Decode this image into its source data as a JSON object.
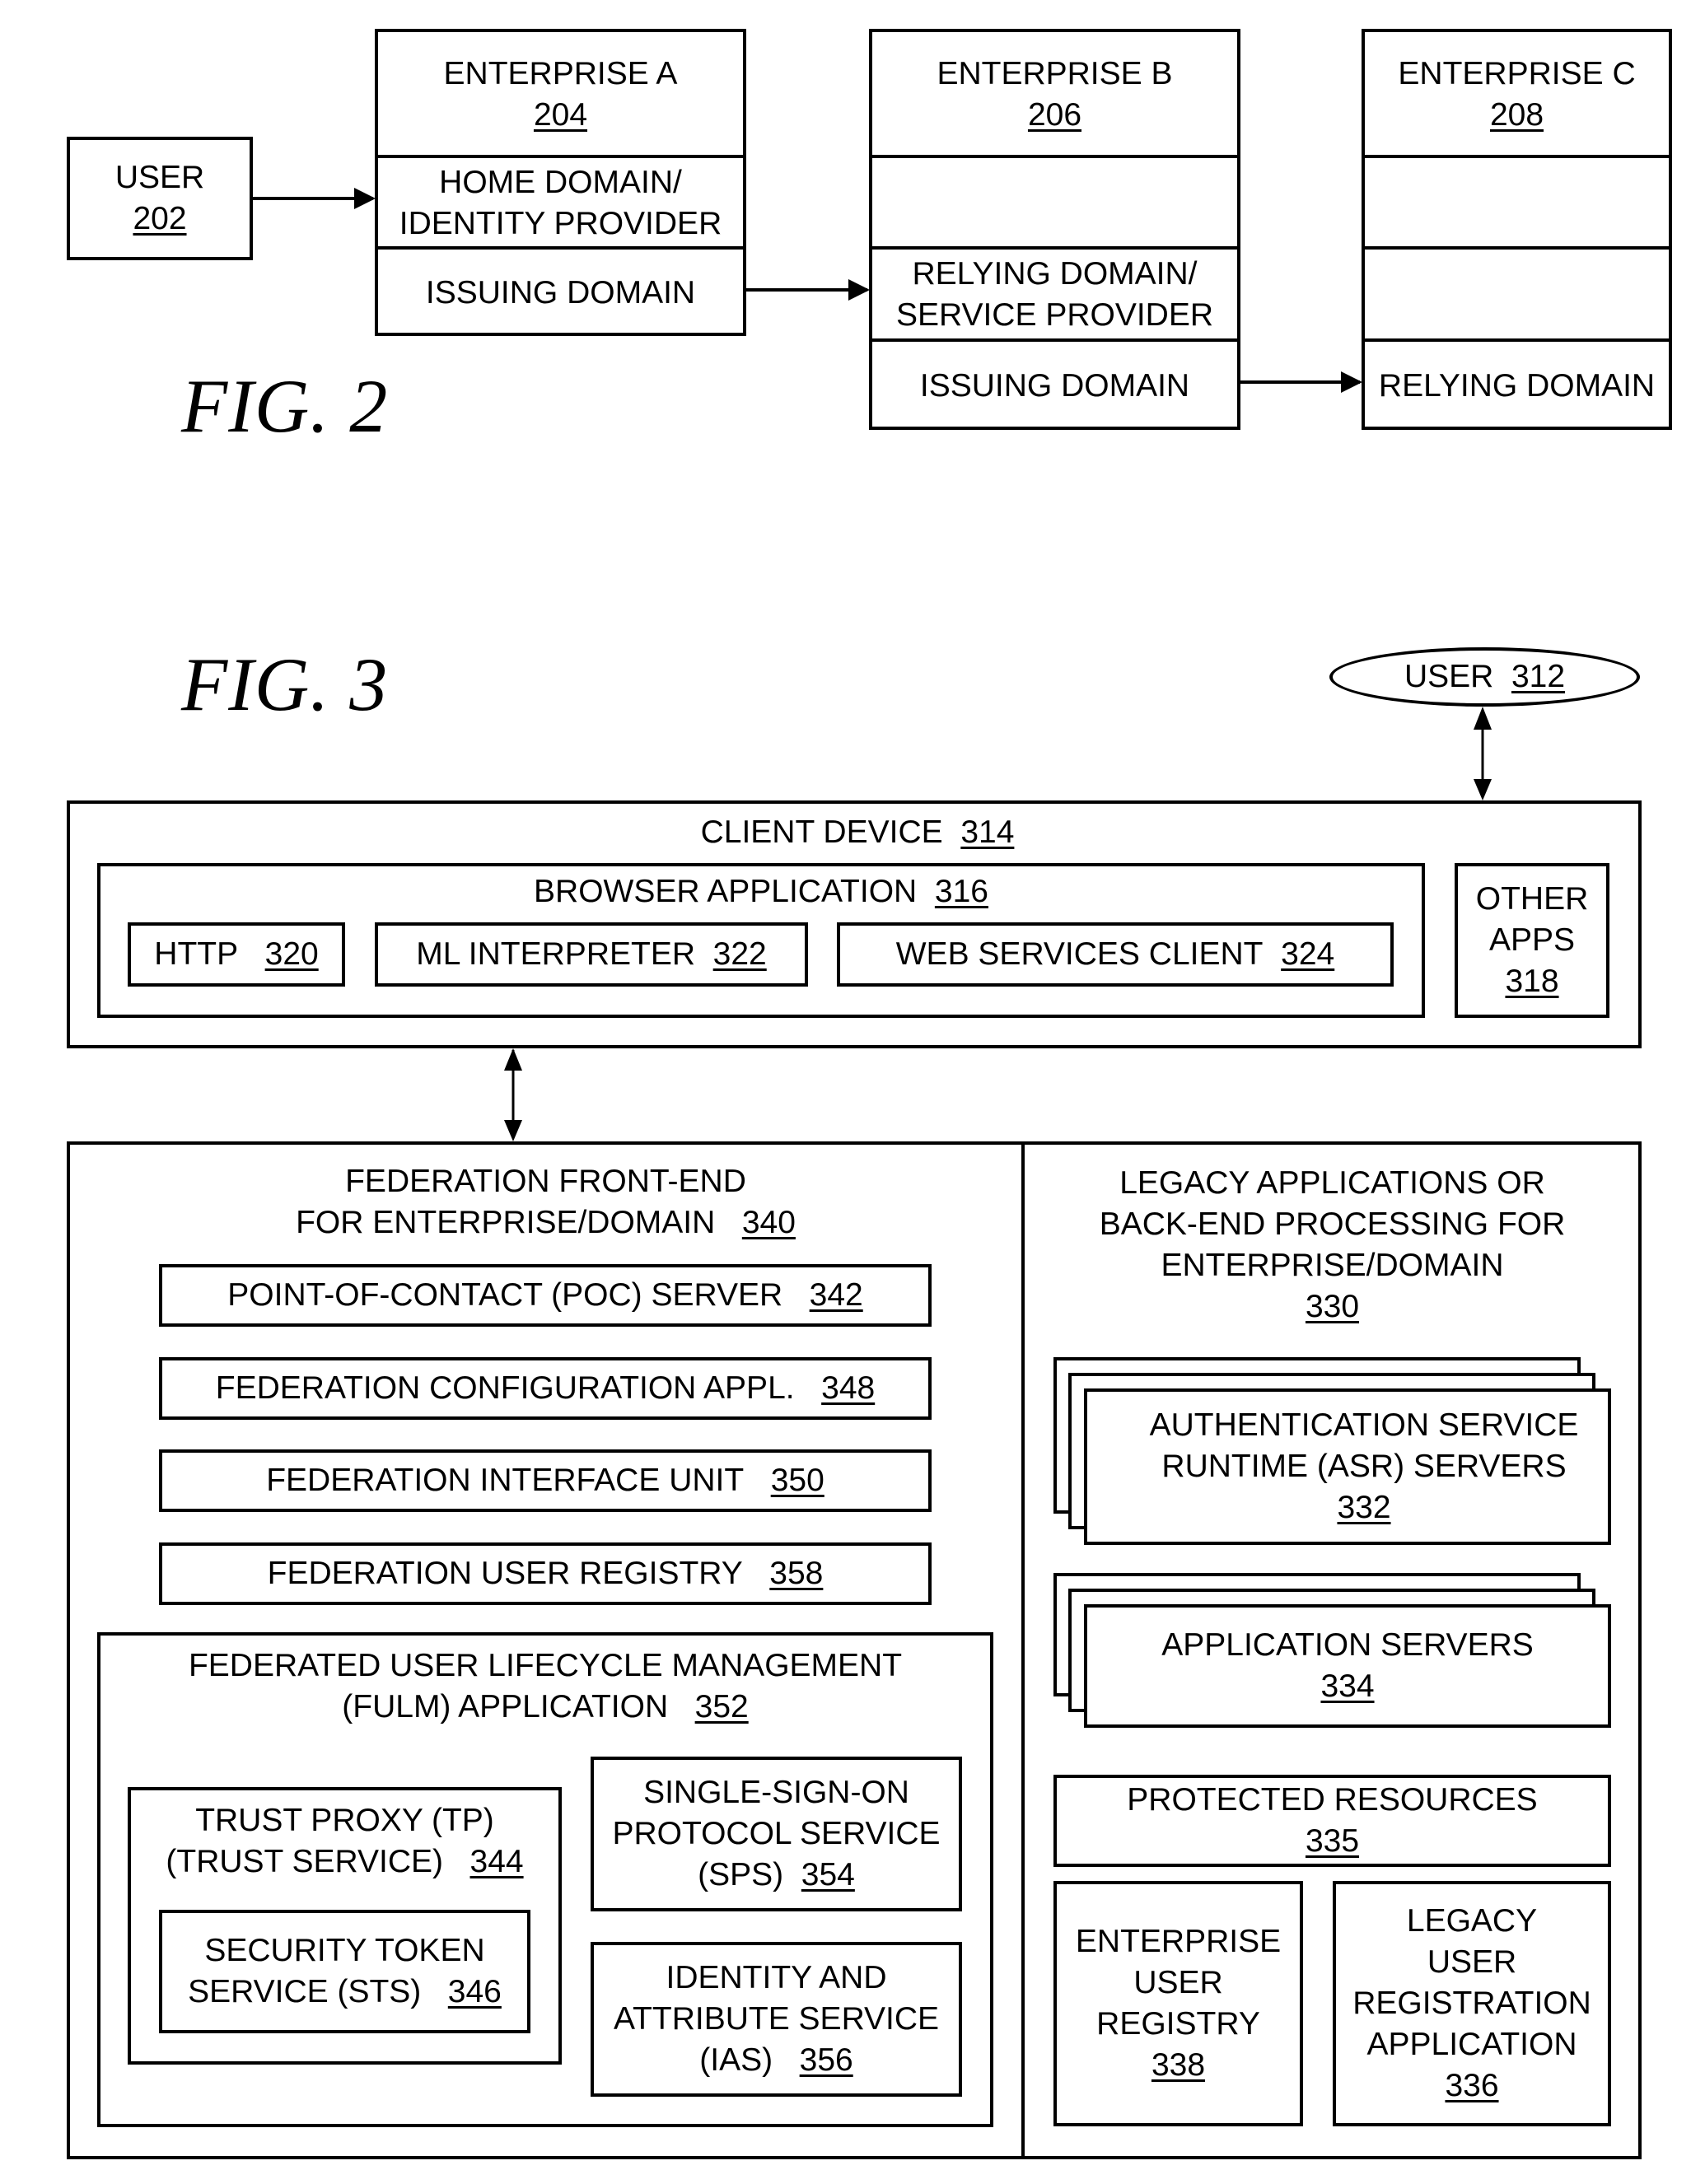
{
  "fig2": {
    "caption": "FIG. 2",
    "user": {
      "label": "USER",
      "num": "202"
    },
    "enterprise_a": {
      "label": "ENTERPRISE A",
      "num": "204",
      "row1_line1": "HOME DOMAIN/",
      "row1_line2": "IDENTITY PROVIDER",
      "row2": "ISSUING DOMAIN"
    },
    "enterprise_b": {
      "label": "ENTERPRISE B",
      "num": "206",
      "row1": "",
      "row2_line1": "RELYING DOMAIN/",
      "row2_line2": "SERVICE PROVIDER",
      "row3": "ISSUING DOMAIN"
    },
    "enterprise_c": {
      "label": "ENTERPRISE C",
      "num": "208",
      "row1": "",
      "row2": "",
      "row3": "RELYING DOMAIN"
    }
  },
  "fig3": {
    "caption": "FIG. 3",
    "user": {
      "label": "USER",
      "num": "312"
    },
    "client_device": {
      "label": "CLIENT DEVICE",
      "num": "314"
    },
    "browser": {
      "label": "BROWSER APPLICATION",
      "num": "316"
    },
    "http": {
      "label": "HTTP",
      "num": "320"
    },
    "ml_interpreter": {
      "label": "ML INTERPRETER",
      "num": "322"
    },
    "web_services_client": {
      "label": "WEB SERVICES CLIENT",
      "num": "324"
    },
    "other_apps": {
      "line1": "OTHER",
      "line2": "APPS",
      "num": "318"
    },
    "federation_front_end": {
      "line1": "FEDERATION FRONT-END",
      "line2": "FOR ENTERPRISE/DOMAIN",
      "num": "340"
    },
    "poc_server": {
      "label": "POINT-OF-CONTACT (POC) SERVER",
      "num": "342"
    },
    "fed_config": {
      "label": "FEDERATION CONFIGURATION APPL.",
      "num": "348"
    },
    "fed_interface": {
      "label": "FEDERATION INTERFACE UNIT",
      "num": "350"
    },
    "fed_registry": {
      "label": "FEDERATION USER REGISTRY",
      "num": "358"
    },
    "fulm": {
      "line1": "FEDERATED USER LIFECYCLE MANAGEMENT",
      "line2": "(FULM) APPLICATION",
      "num": "352"
    },
    "trust_proxy": {
      "line1": "TRUST PROXY (TP)",
      "line2": "(TRUST SERVICE)",
      "num": "344"
    },
    "sts": {
      "line1": "SECURITY TOKEN",
      "line2": "SERVICE (STS)",
      "num": "346"
    },
    "sps": {
      "line1": "SINGLE-SIGN-ON",
      "line2": "PROTOCOL SERVICE",
      "line3": "(SPS)",
      "num": "354"
    },
    "ias": {
      "line1": "IDENTITY AND",
      "line2": "ATTRIBUTE SERVICE",
      "line3": "(IAS)",
      "num": "356"
    },
    "legacy": {
      "line1": "LEGACY APPLICATIONS OR",
      "line2": "BACK-END PROCESSING FOR",
      "line3": "ENTERPRISE/DOMAIN",
      "num": "330"
    },
    "asr": {
      "line1": "AUTHENTICATION SERVICE",
      "line2": "RUNTIME (ASR) SERVERS",
      "num": "332"
    },
    "app_servers": {
      "label": "APPLICATION SERVERS",
      "num": "334"
    },
    "protected": {
      "label": "PROTECTED RESOURCES",
      "num": "335"
    },
    "ent_registry": {
      "line1": "ENTERPRISE",
      "line2": "USER",
      "line3": "REGISTRY",
      "num": "338"
    },
    "legacy_reg_app": {
      "line1": "LEGACY",
      "line2": "USER",
      "line3": "REGISTRATION",
      "line4": "APPLICATION",
      "num": "336"
    }
  }
}
